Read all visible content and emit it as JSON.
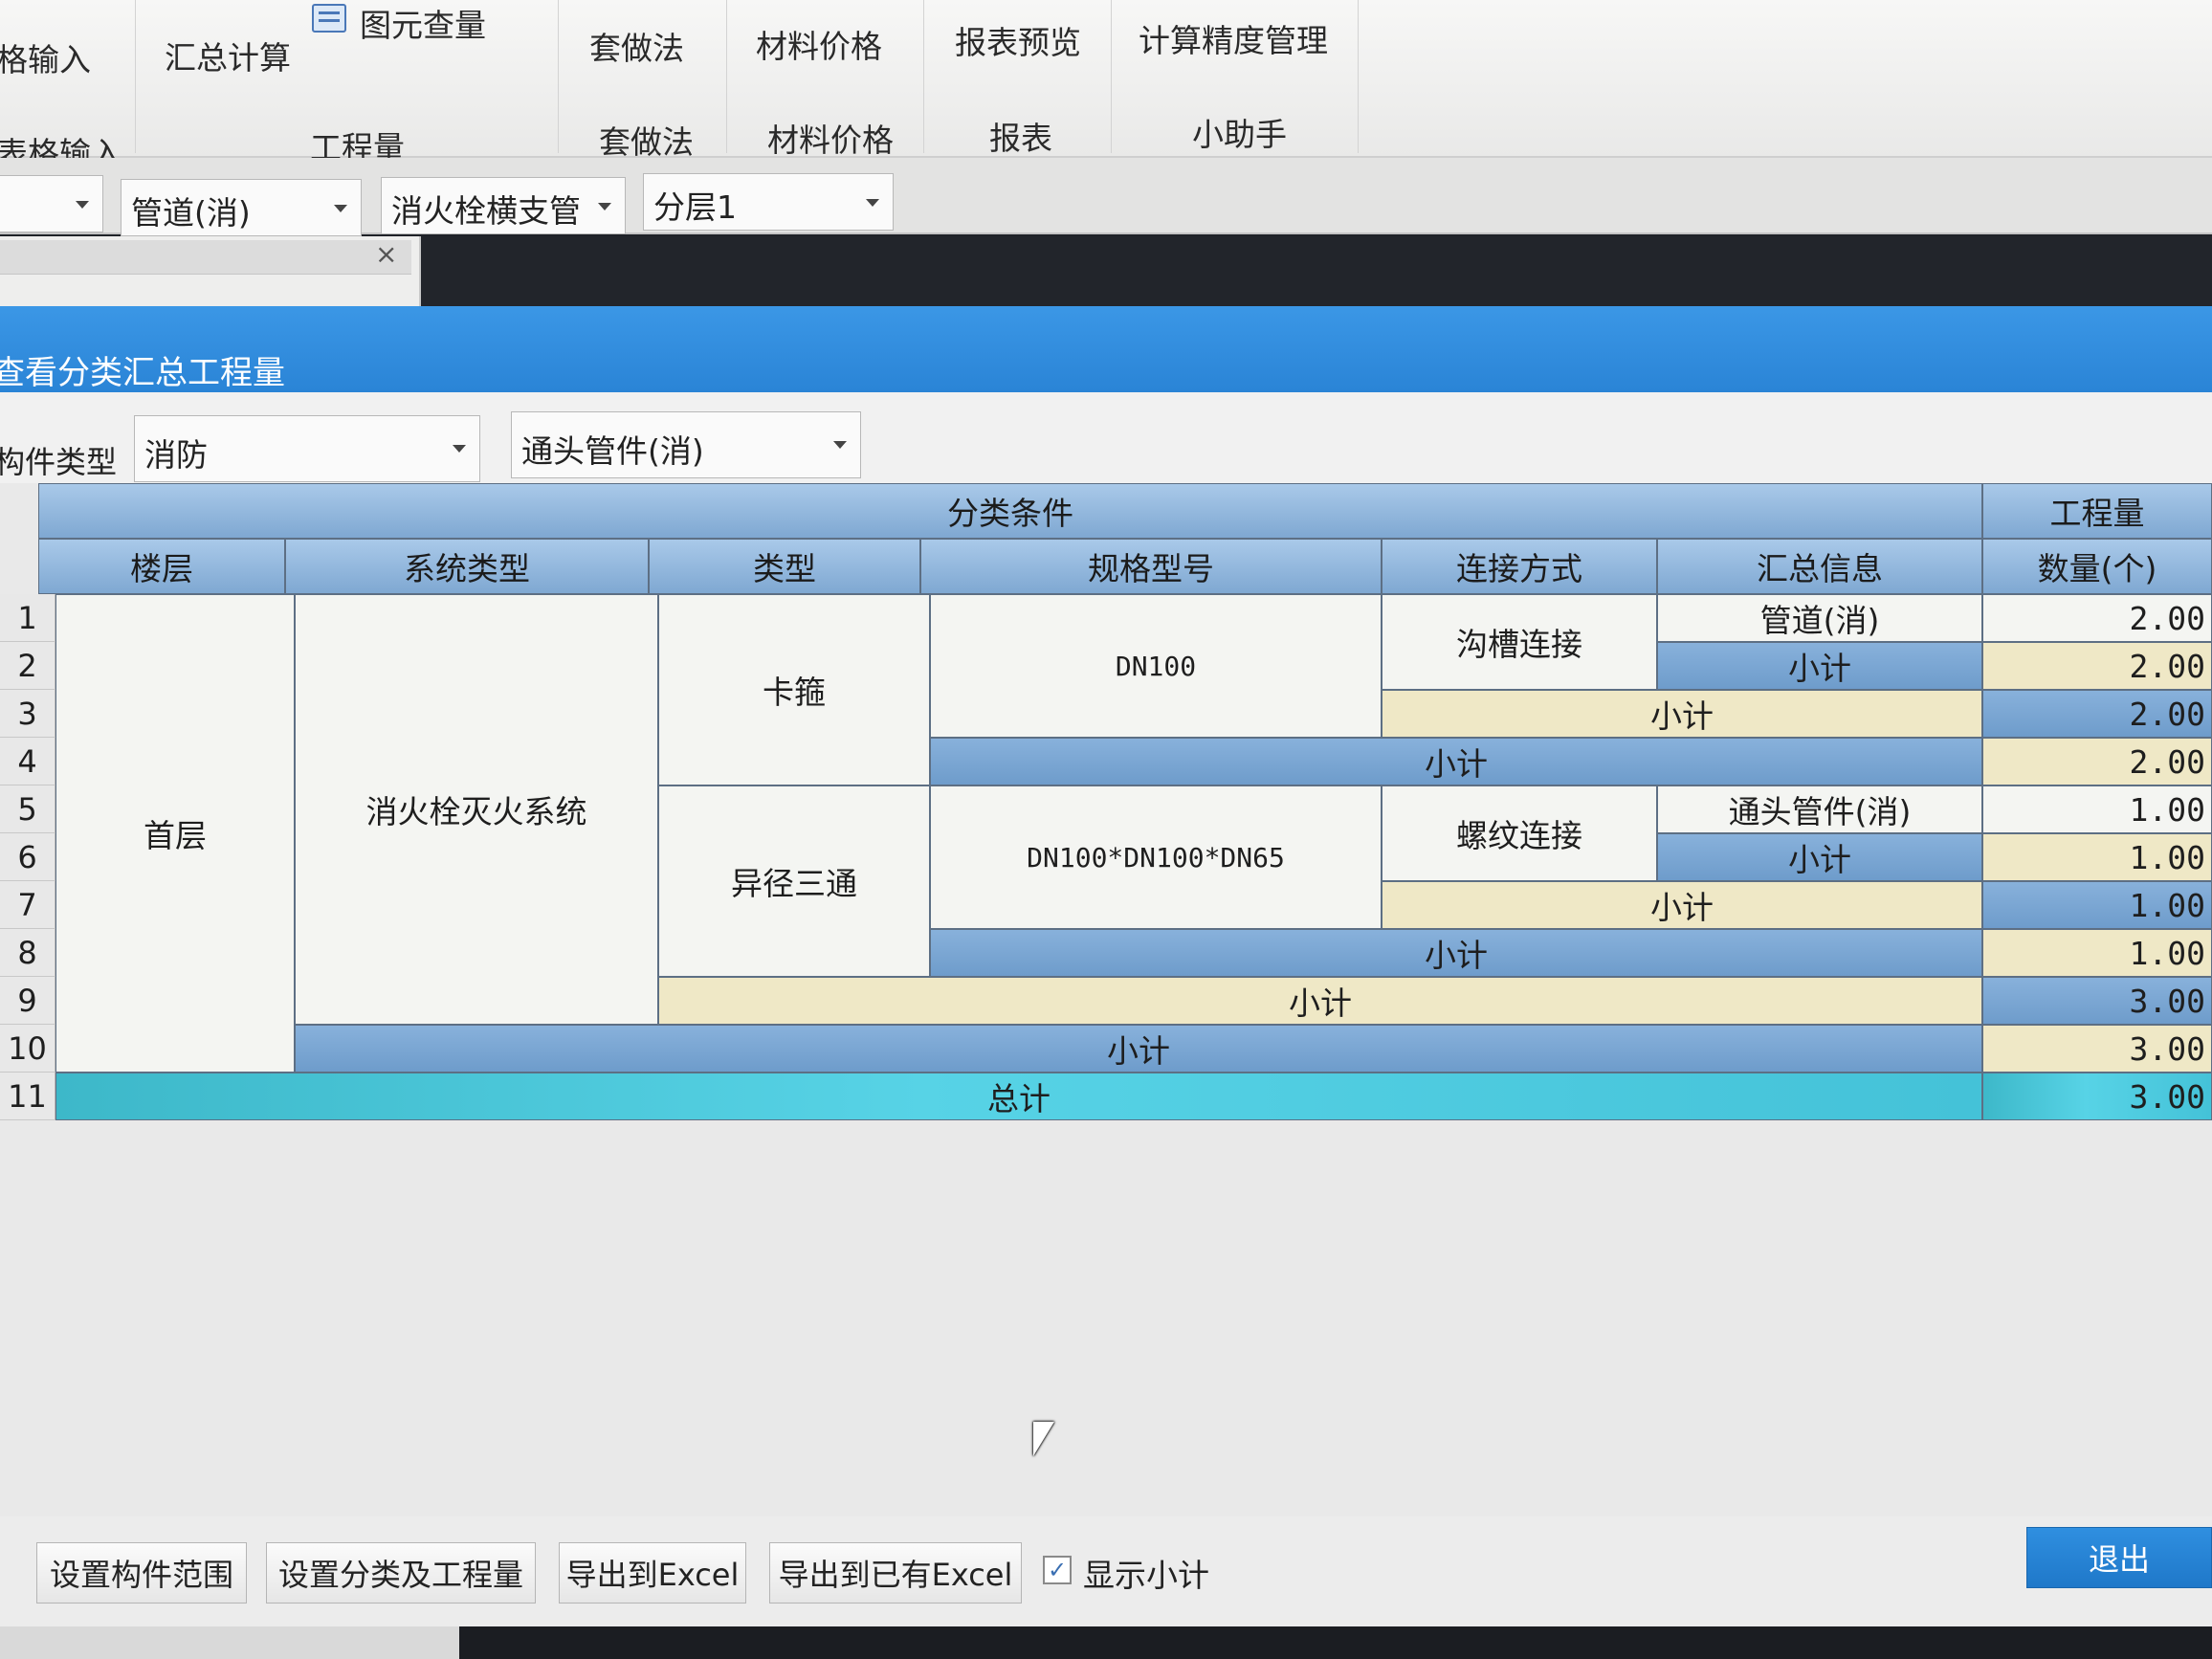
{
  "ribbon": {
    "left_top": "格输入",
    "left_bottom": "表格输入",
    "summary_calc": "汇总计算",
    "element_query": "图元查量",
    "quantity_group": "工程量",
    "set_method_btn": "套做法",
    "set_method_group": "套做法",
    "material_price_btn": "材料价格",
    "material_price_group": "材料价格",
    "report_preview_btn": "报表预览",
    "report_group": "报表",
    "precision_btn": "计算精度管理",
    "assistant_group": "小助手"
  },
  "selectors": {
    "pipe": "管道(消)",
    "branch": "消火栓横支管",
    "layer": "分层1"
  },
  "dialog": {
    "title": "查看分类汇总工程量",
    "component_type_label": "构件类型",
    "category_value": "消防",
    "subtype_value": "通头管件(消)"
  },
  "table": {
    "group_header": "分类条件",
    "quantity_header": "工程量",
    "columns": [
      "楼层",
      "系统类型",
      "类型",
      "规格型号",
      "连接方式",
      "汇总信息"
    ],
    "quantity_col": "数量(个)",
    "row_numbers": [
      "1",
      "2",
      "3",
      "4",
      "5",
      "6",
      "7",
      "8",
      "9",
      "10",
      "11"
    ],
    "floor": "首层",
    "system": "消火栓灭火系统",
    "type_1": "卡箍",
    "spec_1": "DN100",
    "conn_1": "沟槽连接",
    "info_1": "管道(消)",
    "type_2": "异径三通",
    "spec_2": "DN100*DN100*DN65",
    "conn_2": "螺纹连接",
    "info_2": "通头管件(消)",
    "subtotal": "小计",
    "total": "总计",
    "quantities": [
      "2.00",
      "2.00",
      "2.00",
      "2.00",
      "1.00",
      "1.00",
      "1.00",
      "1.00",
      "3.00",
      "3.00",
      "3.00"
    ]
  },
  "footer": {
    "set_range": "设置构件范围",
    "set_classify": "设置分类及工程量",
    "export_excel": "导出到Excel",
    "export_existing": "导出到已有Excel",
    "show_subtotal": "显示小计",
    "show_subtotal_checked": true,
    "exit": "退出"
  }
}
